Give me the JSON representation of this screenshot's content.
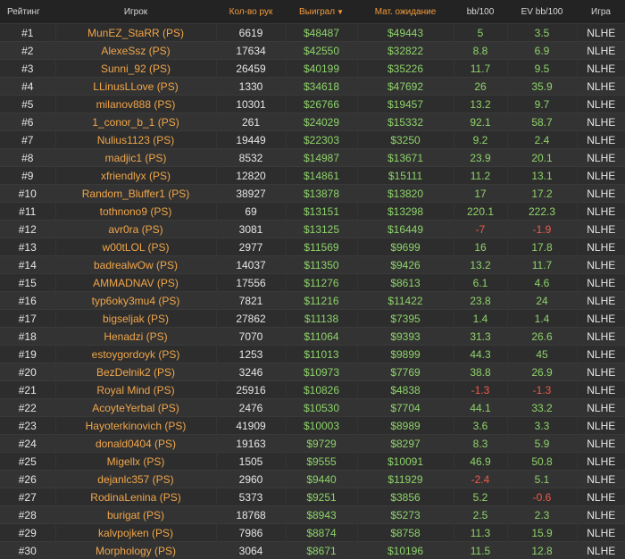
{
  "headers": {
    "rank": "Рейтинг",
    "player": "Игрок",
    "hands": "Кол-во рук",
    "won": "Выиграл",
    "won_sort_icon": "caret-down-icon",
    "ev": "Мат. ожидание",
    "bb": "bb/100",
    "ev_bb": "EV bb/100",
    "game": "Игра"
  },
  "colors": {
    "player": "#f0a64a",
    "positive": "#8ed36a",
    "negative": "#f05a4a",
    "header_accent": "#f29a3a"
  },
  "rows": [
    {
      "rank": "#1",
      "player": "MunEZ_StaRR (PS)",
      "hands": "6619",
      "won": "$48487",
      "ev": "$49443",
      "bb": "5",
      "ev_bb": "3.5",
      "game": "NLHE"
    },
    {
      "rank": "#2",
      "player": "AlexeSsz (PS)",
      "hands": "17634",
      "won": "$42550",
      "ev": "$32822",
      "bb": "8.8",
      "ev_bb": "6.9",
      "game": "NLHE"
    },
    {
      "rank": "#3",
      "player": "Sunni_92 (PS)",
      "hands": "26459",
      "won": "$40199",
      "ev": "$35226",
      "bb": "11.7",
      "ev_bb": "9.5",
      "game": "NLHE"
    },
    {
      "rank": "#4",
      "player": "LLinusLLove (PS)",
      "hands": "1330",
      "won": "$34618",
      "ev": "$47692",
      "bb": "26",
      "ev_bb": "35.9",
      "game": "NLHE"
    },
    {
      "rank": "#5",
      "player": "milanov888 (PS)",
      "hands": "10301",
      "won": "$26766",
      "ev": "$19457",
      "bb": "13.2",
      "ev_bb": "9.7",
      "game": "NLHE"
    },
    {
      "rank": "#6",
      "player": "1_conor_b_1 (PS)",
      "hands": "261",
      "won": "$24029",
      "ev": "$15332",
      "bb": "92.1",
      "ev_bb": "58.7",
      "game": "NLHE"
    },
    {
      "rank": "#7",
      "player": "Nulius1123 (PS)",
      "hands": "19449",
      "won": "$22303",
      "ev": "$3250",
      "bb": "9.2",
      "ev_bb": "2.4",
      "game": "NLHE"
    },
    {
      "rank": "#8",
      "player": "madjic1 (PS)",
      "hands": "8532",
      "won": "$14987",
      "ev": "$13671",
      "bb": "23.9",
      "ev_bb": "20.1",
      "game": "NLHE"
    },
    {
      "rank": "#9",
      "player": "xfriendlyx (PS)",
      "hands": "12820",
      "won": "$14861",
      "ev": "$15111",
      "bb": "11.2",
      "ev_bb": "13.1",
      "game": "NLHE"
    },
    {
      "rank": "#10",
      "player": "Random_Bluffer1 (PS)",
      "hands": "38927",
      "won": "$13878",
      "ev": "$13820",
      "bb": "17",
      "ev_bb": "17.2",
      "game": "NLHE"
    },
    {
      "rank": "#11",
      "player": "tothnono9 (PS)",
      "hands": "69",
      "won": "$13151",
      "ev": "$13298",
      "bb": "220.1",
      "ev_bb": "222.3",
      "game": "NLHE"
    },
    {
      "rank": "#12",
      "player": "avr0ra (PS)",
      "hands": "3081",
      "won": "$13125",
      "ev": "$16449",
      "bb": "-7",
      "ev_bb": "-1.9",
      "game": "NLHE"
    },
    {
      "rank": "#13",
      "player": "w00tLOL (PS)",
      "hands": "2977",
      "won": "$11569",
      "ev": "$9699",
      "bb": "16",
      "ev_bb": "17.8",
      "game": "NLHE"
    },
    {
      "rank": "#14",
      "player": "badrealwOw (PS)",
      "hands": "14037",
      "won": "$11350",
      "ev": "$9426",
      "bb": "13.2",
      "ev_bb": "11.7",
      "game": "NLHE"
    },
    {
      "rank": "#15",
      "player": "AMMADNAV (PS)",
      "hands": "17556",
      "won": "$11276",
      "ev": "$8613",
      "bb": "6.1",
      "ev_bb": "4.6",
      "game": "NLHE"
    },
    {
      "rank": "#16",
      "player": "typ6oky3mu4 (PS)",
      "hands": "7821",
      "won": "$11216",
      "ev": "$11422",
      "bb": "23.8",
      "ev_bb": "24",
      "game": "NLHE"
    },
    {
      "rank": "#17",
      "player": "bigseljak (PS)",
      "hands": "27862",
      "won": "$11138",
      "ev": "$7395",
      "bb": "1.4",
      "ev_bb": "1.4",
      "game": "NLHE"
    },
    {
      "rank": "#18",
      "player": "Henadzi (PS)",
      "hands": "7070",
      "won": "$11064",
      "ev": "$9393",
      "bb": "31.3",
      "ev_bb": "26.6",
      "game": "NLHE"
    },
    {
      "rank": "#19",
      "player": "estoygordoyk (PS)",
      "hands": "1253",
      "won": "$11013",
      "ev": "$9899",
      "bb": "44.3",
      "ev_bb": "45",
      "game": "NLHE"
    },
    {
      "rank": "#20",
      "player": "BezDelnik2 (PS)",
      "hands": "3246",
      "won": "$10973",
      "ev": "$7769",
      "bb": "38.8",
      "ev_bb": "26.9",
      "game": "NLHE"
    },
    {
      "rank": "#21",
      "player": "Royal Mind (PS)",
      "hands": "25916",
      "won": "$10826",
      "ev": "$4838",
      "bb": "-1.3",
      "ev_bb": "-1.3",
      "game": "NLHE"
    },
    {
      "rank": "#22",
      "player": "AcoyteYerbal (PS)",
      "hands": "2476",
      "won": "$10530",
      "ev": "$7704",
      "bb": "44.1",
      "ev_bb": "33.2",
      "game": "NLHE"
    },
    {
      "rank": "#23",
      "player": "Hayoterkinovich (PS)",
      "hands": "41909",
      "won": "$10003",
      "ev": "$8989",
      "bb": "3.6",
      "ev_bb": "3.3",
      "game": "NLHE"
    },
    {
      "rank": "#24",
      "player": "donald0404 (PS)",
      "hands": "19163",
      "won": "$9729",
      "ev": "$8297",
      "bb": "8.3",
      "ev_bb": "5.9",
      "game": "NLHE"
    },
    {
      "rank": "#25",
      "player": "Migellx (PS)",
      "hands": "1505",
      "won": "$9555",
      "ev": "$10091",
      "bb": "46.9",
      "ev_bb": "50.8",
      "game": "NLHE"
    },
    {
      "rank": "#26",
      "player": "dejanlc357 (PS)",
      "hands": "2960",
      "won": "$9440",
      "ev": "$11929",
      "bb": "-2.4",
      "ev_bb": "5.1",
      "game": "NLHE"
    },
    {
      "rank": "#27",
      "player": "RodinaLenina (PS)",
      "hands": "5373",
      "won": "$9251",
      "ev": "$3856",
      "bb": "5.2",
      "ev_bb": "-0.6",
      "game": "NLHE"
    },
    {
      "rank": "#28",
      "player": "burigat (PS)",
      "hands": "18768",
      "won": "$8943",
      "ev": "$5273",
      "bb": "2.5",
      "ev_bb": "2.3",
      "game": "NLHE"
    },
    {
      "rank": "#29",
      "player": "kalvpojken (PS)",
      "hands": "7986",
      "won": "$8874",
      "ev": "$8758",
      "bb": "11.3",
      "ev_bb": "15.9",
      "game": "NLHE"
    },
    {
      "rank": "#30",
      "player": "Morphology (PS)",
      "hands": "3064",
      "won": "$8671",
      "ev": "$10196",
      "bb": "11.5",
      "ev_bb": "12.8",
      "game": "NLHE"
    }
  ]
}
